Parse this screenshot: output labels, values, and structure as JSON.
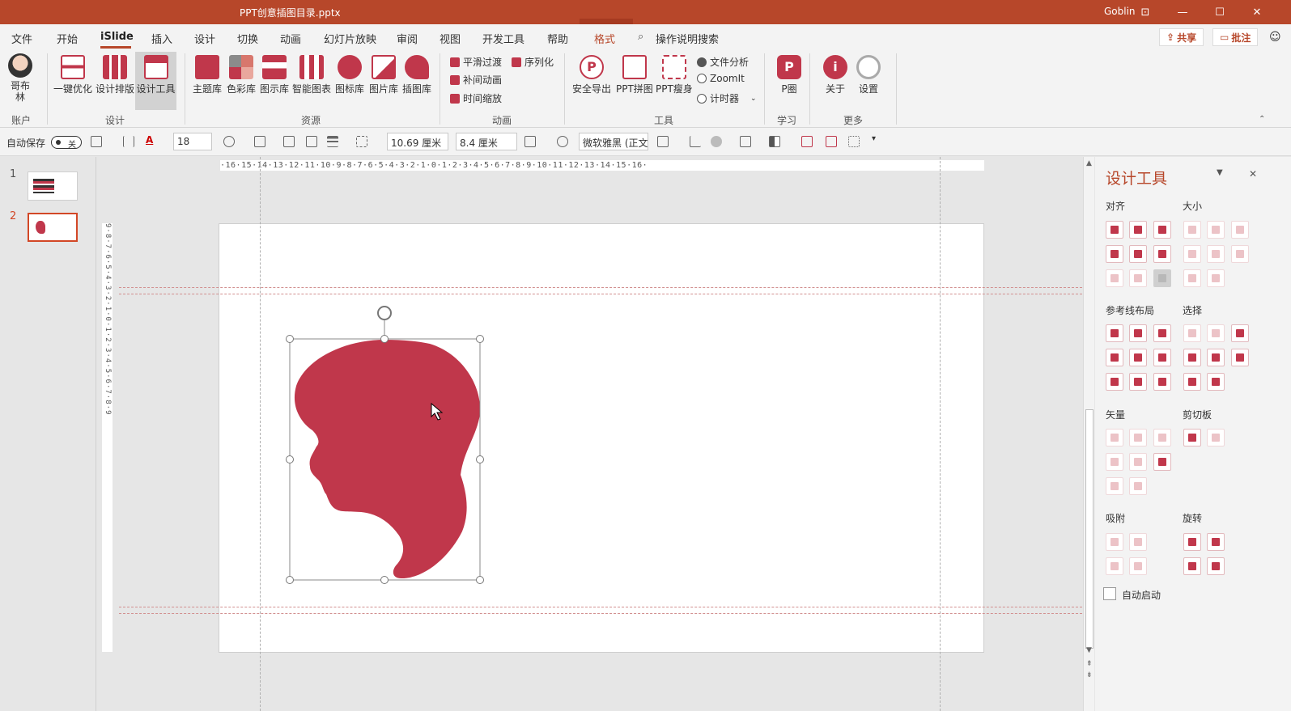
{
  "window": {
    "title": "PPT创意插图目录.pptx",
    "user": "Goblin",
    "buttons": [
      "⊡",
      "—",
      "☐",
      "✕"
    ]
  },
  "menu": {
    "items": [
      "文件",
      "开始",
      "iSlide",
      "插入",
      "设计",
      "切换",
      "动画",
      "幻灯片放映",
      "审阅",
      "视图",
      "开发工具",
      "帮助",
      "格式"
    ],
    "active": "iSlide",
    "search": "操作说明搜索",
    "share": "共享",
    "comment": "批注"
  },
  "ribbon": {
    "account": {
      "label": "哥布林",
      "group": "账户"
    },
    "design": {
      "items": [
        "一键优化",
        "设计排版",
        "设计工具"
      ],
      "group": "设计"
    },
    "resources": {
      "items": [
        "主题库",
        "色彩库",
        "图示库",
        "智能图表",
        "图标库",
        "图片库",
        "插图库"
      ],
      "group": "资源"
    },
    "animation": {
      "items": [
        "平滑过渡",
        "序列化",
        "补间动画",
        "时间缩放"
      ],
      "group": "动画"
    },
    "tools": {
      "items": [
        "安全导出",
        "PPT拼图",
        "PPT瘦身",
        "文件分析",
        "ZoomIt",
        "计时器"
      ],
      "group": "工具"
    },
    "learn": {
      "items": [
        "P圈"
      ],
      "group": "学习"
    },
    "more": {
      "items": [
        "关于",
        "设置"
      ],
      "group": "更多"
    }
  },
  "toolbar": {
    "autosave": "自动保存",
    "autosave_state": "关",
    "font_size": "18",
    "width": "10.69 厘米",
    "height": "8.4 厘米",
    "font_name": "微软雅黑 (正文"
  },
  "slides": {
    "numbers": [
      "1",
      "2"
    ],
    "selected": 2
  },
  "ruler": {
    "h": "·16·15·14·13·12·11·10·9·8·7·6·5·4·3·2·1·0·1·2·3·4·5·6·7·8·9·10·11·12·13·14·15·16·",
    "v": "9·8·7·6·5·4·3·2·1·0·1·2·3·4·5·6·7·8·9"
  },
  "shape": {
    "color": "#c0374b",
    "selection_stroke": "#8a8a8a"
  },
  "panel": {
    "title": "设计工具",
    "sections": {
      "align": "对齐",
      "size": "大小",
      "guides": "参考线布局",
      "select": "选择",
      "vector": "矢量",
      "clipboard": "剪切板",
      "snap": "吸附",
      "rotate": "旋转"
    },
    "auto_start": "自动启动"
  },
  "colors": {
    "accent": "#b7472a",
    "brand_red": "#c0374b"
  }
}
